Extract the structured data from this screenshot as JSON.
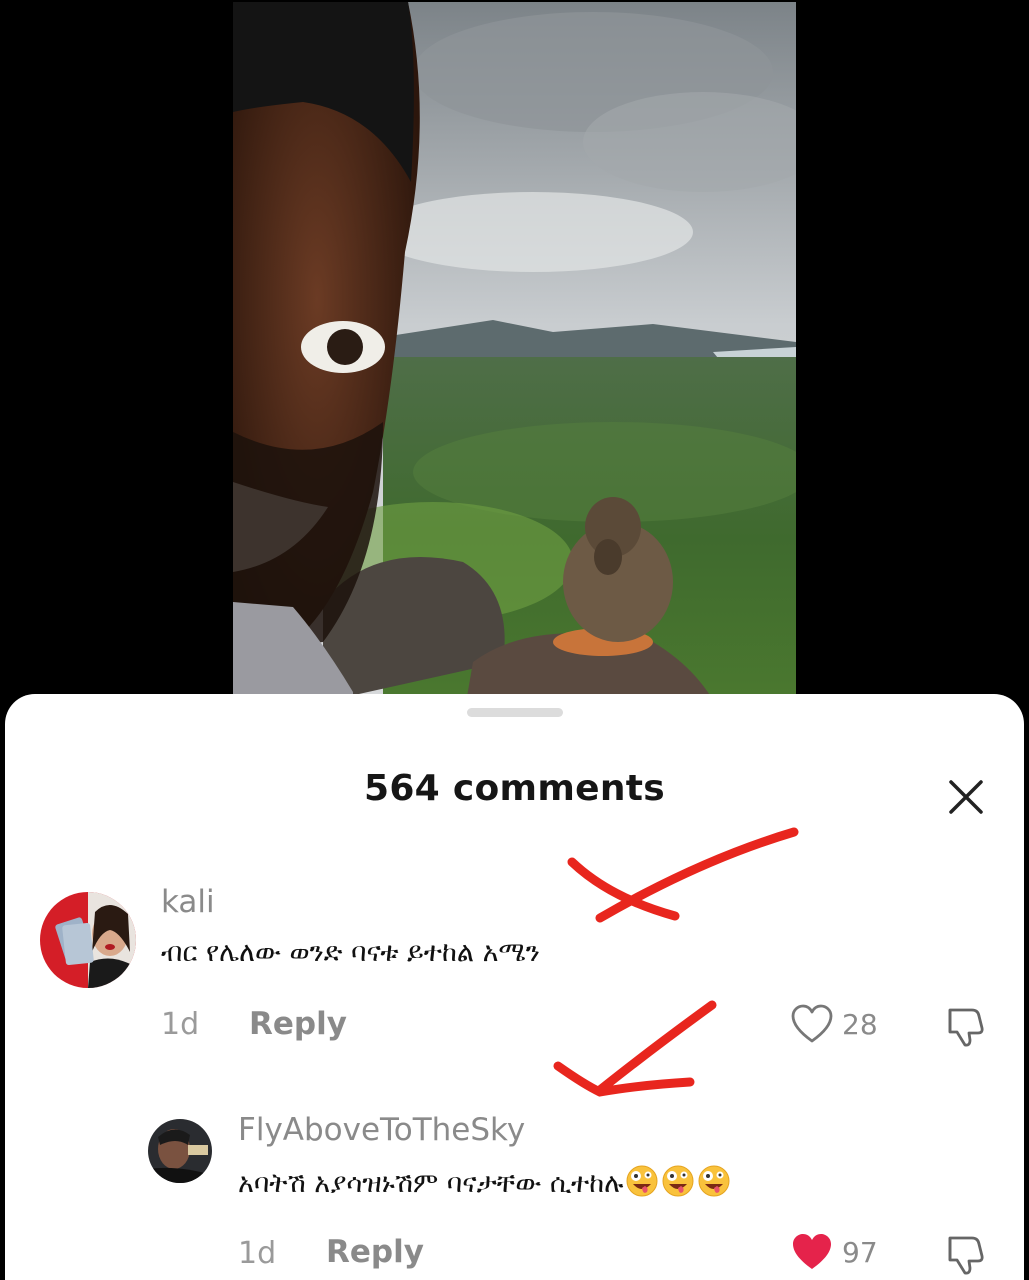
{
  "header": {
    "comments_count_label": "564 comments"
  },
  "comments": [
    {
      "username": "kali",
      "text": "ብር የሌለው ወንድ ባናቱ ይተከል አሜን",
      "date": "1d",
      "reply_label": "Reply",
      "likes": "28",
      "liked": false
    },
    {
      "username": "FlyAboveToTheSky",
      "text": "አባትሽ አያሳዝኑሽም ባናታቸው ሲተከሉ",
      "emoji_count": 3,
      "date": "1d",
      "reply_label": "Reply",
      "likes": "97",
      "liked": true
    }
  ],
  "icons": {
    "close": "close-icon",
    "like": "heart-icon",
    "dislike": "thumbs-down-icon",
    "emoji": "zany-face-emoji"
  },
  "colors": {
    "like_active": "#e5234b",
    "annotation": "#e8261e",
    "muted_text": "#8a8a8a"
  }
}
